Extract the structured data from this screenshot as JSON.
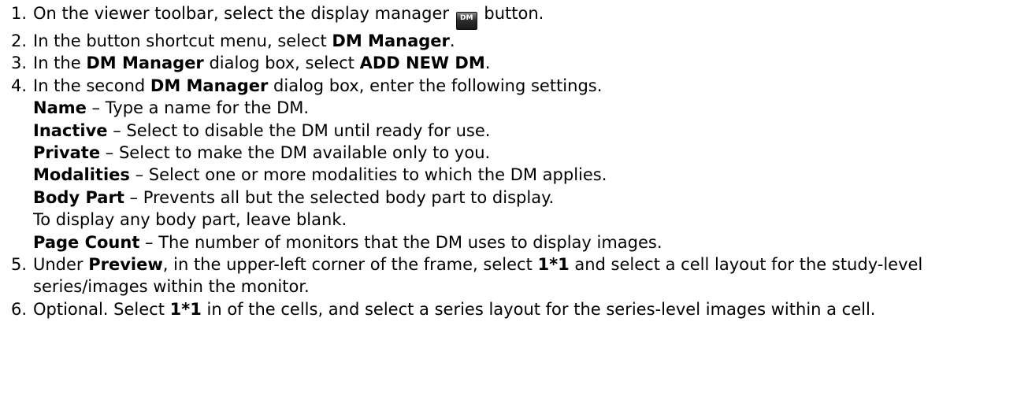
{
  "steps": [
    {
      "num": "1.",
      "a": "On the viewer toolbar, select the display manager ",
      "icon_text": "DM",
      "icon_name": "display-manager-icon",
      "b": " button."
    },
    {
      "num": "2.",
      "a": "In the button shortcut menu, select ",
      "b1": "DM Manager",
      "c": "."
    },
    {
      "num": "3.",
      "a": "In the ",
      "b1": "DM Manager",
      "c": " dialog box, select ",
      "b2": "ADD NEW DM",
      "d": "."
    },
    {
      "num": "4.",
      "a": "In the second ",
      "b1": "DM Manager",
      "c": " dialog box, enter the following settings.",
      "settings": [
        {
          "term": "Name",
          "desc": " – Type a name for the DM."
        },
        {
          "term": "Inactive",
          "desc": " – Select to disable the DM until ready for use."
        },
        {
          "term": "Private",
          "desc": " – Select to make the DM available only to you."
        },
        {
          "term": "Modalities",
          "desc": " – Select one or more modalities to which the DM applies."
        },
        {
          "term": "Body Part",
          "desc": " – Prevents all but the selected body part to display."
        },
        {
          "term": "",
          "desc": "To display any body part, leave blank."
        },
        {
          "term": "Page Count",
          "desc": " – The number of monitors that the DM uses to display images."
        }
      ]
    },
    {
      "num": "5.",
      "a": "Under ",
      "b1": "Preview",
      "c": ", in the upper-left corner of the frame, select ",
      "b2": "1*1",
      "d": " and select a cell layout for the study-level series/images within the monitor."
    },
    {
      "num": "6.",
      "a": "Optional. Select ",
      "b1": "1*1",
      "c": " in of the cells, and select a series layout for the series-level images within a cell."
    }
  ]
}
